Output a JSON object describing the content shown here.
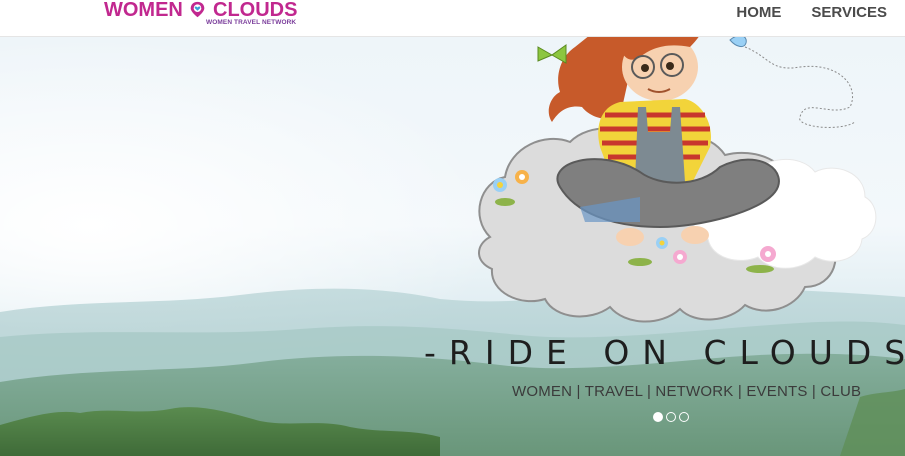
{
  "header": {
    "logo": {
      "text_left": "WOMEN",
      "text_right": "CLOUDS",
      "subtitle": "WOMEN TRAVEL NETWORK",
      "brand_color": "#c1288f",
      "pin_color": "#3aa0d8"
    },
    "nav": [
      {
        "label": "HOME"
      },
      {
        "label": "SERVICES"
      }
    ]
  },
  "hero": {
    "headline": "-RIDE ON CLOUDS-",
    "tagline": "WOMEN | TRAVEL | NETWORK | EVENTS | CLUB",
    "illustration": "girl-sitting-on-cloud",
    "slides": {
      "count": 3,
      "active_index": 0
    }
  }
}
